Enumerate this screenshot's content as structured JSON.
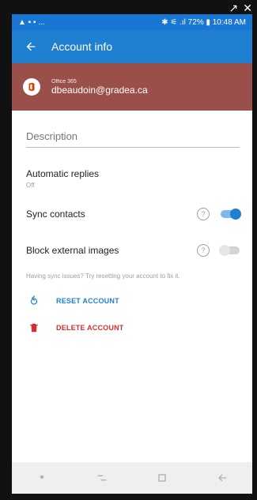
{
  "appbar": {
    "title": "Account info"
  },
  "status": {
    "right": "✱ ⚟ .ıl 72% ▮ 10:48 AM",
    "left": "▲ ▪ ▪ ..."
  },
  "account": {
    "provider": "Office 365",
    "email": "dbeaudoin@gradea.ca"
  },
  "fields": {
    "description_placeholder": "Description"
  },
  "settings": {
    "automatic_replies": {
      "label": "Automatic replies",
      "value": "Off"
    },
    "sync_contacts": {
      "label": "Sync contacts",
      "enabled": true
    },
    "block_external_images": {
      "label": "Block external images",
      "enabled": false
    }
  },
  "help": {
    "sync_issues": "Having sync issues? Try resetting your account to fix it."
  },
  "actions": {
    "reset": "RESET ACCOUNT",
    "delete": "DELETE ACCOUNT"
  },
  "colors": {
    "primary": "#1f7fd0",
    "danger": "#d32f2f",
    "banner": "#9a4f4a"
  },
  "icons": {
    "back": "arrow-left-icon",
    "office": "office-icon",
    "help": "help-circle-icon",
    "reset": "refresh-icon",
    "delete": "trash-icon",
    "nav_menu": "menu-icon",
    "nav_home": "square-icon",
    "nav_back": "back-icon"
  }
}
